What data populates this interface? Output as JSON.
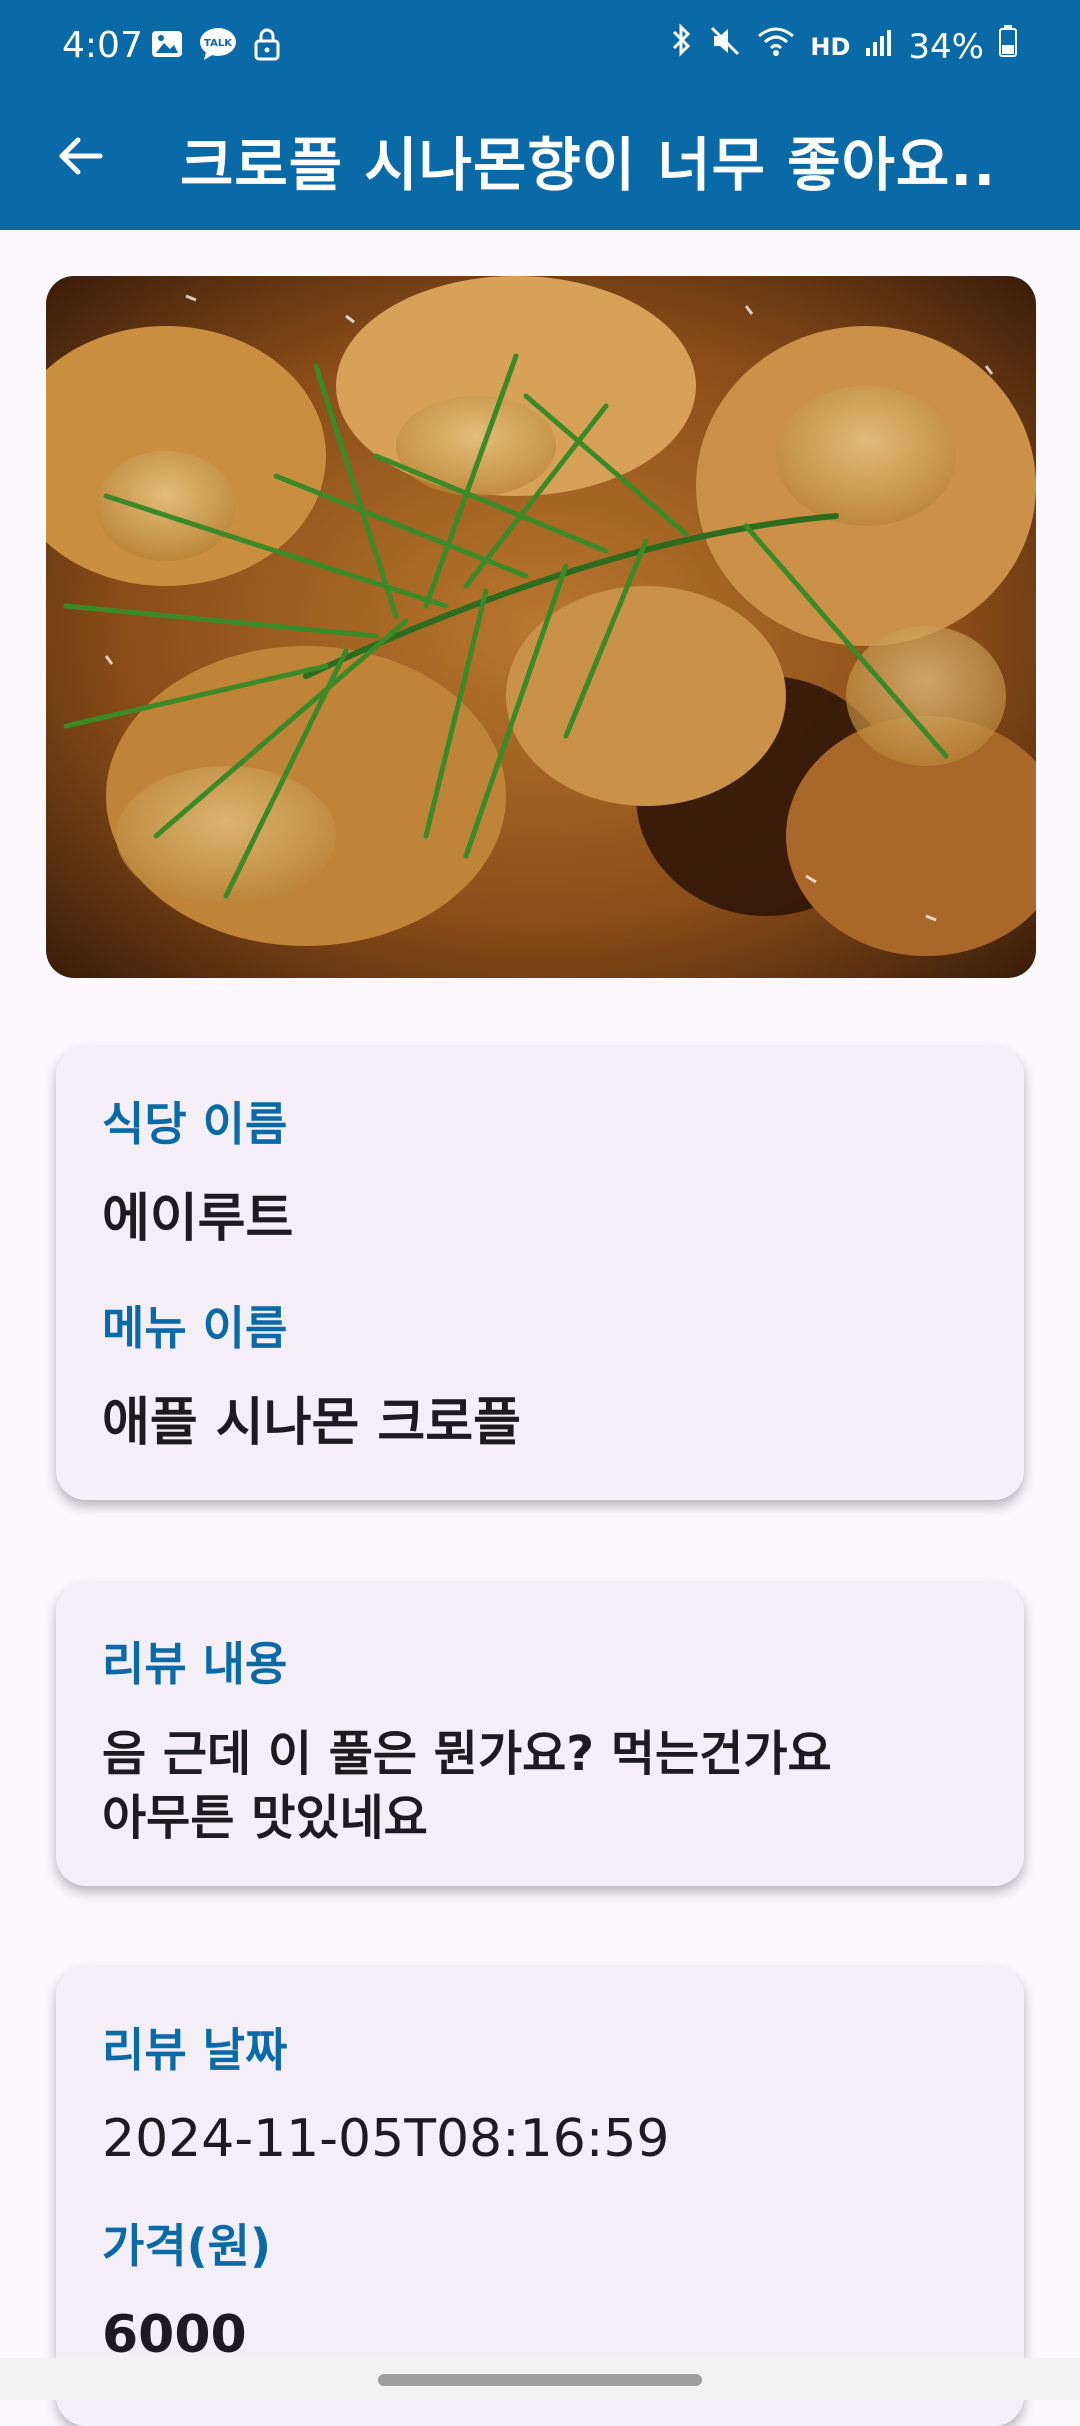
{
  "status_bar": {
    "time": "4:07",
    "battery": "34%",
    "network": "HD",
    "left_icons": [
      "image-icon",
      "talk-icon",
      "lock-icon"
    ],
    "right_icons": [
      "bluetooth-icon",
      "mute-icon",
      "wifi-icon",
      "hd-voice-icon",
      "signal-icon",
      "battery-icon"
    ]
  },
  "app_bar": {
    "title": "크로플 시나몬향이 너무 좋아요..",
    "back_icon": "arrow-back-icon",
    "color": "#0a6aa8"
  },
  "hero_image": {
    "description": "croffle-photo"
  },
  "details": {
    "restaurant_label": "식당 이름",
    "restaurant_value": "에이루트",
    "menu_label": "메뉴 이름",
    "menu_value": "애플 시나몬 크로플"
  },
  "review": {
    "label": "리뷰 내용",
    "content": "음 근데 이 풀은 뭔가요? 먹는건가요\n아무튼 맛있네요"
  },
  "meta": {
    "date_label": "리뷰 날짜",
    "date_value": "2024-11-05T08:16:59",
    "price_label": "가격(원)",
    "price_value": "6000"
  }
}
